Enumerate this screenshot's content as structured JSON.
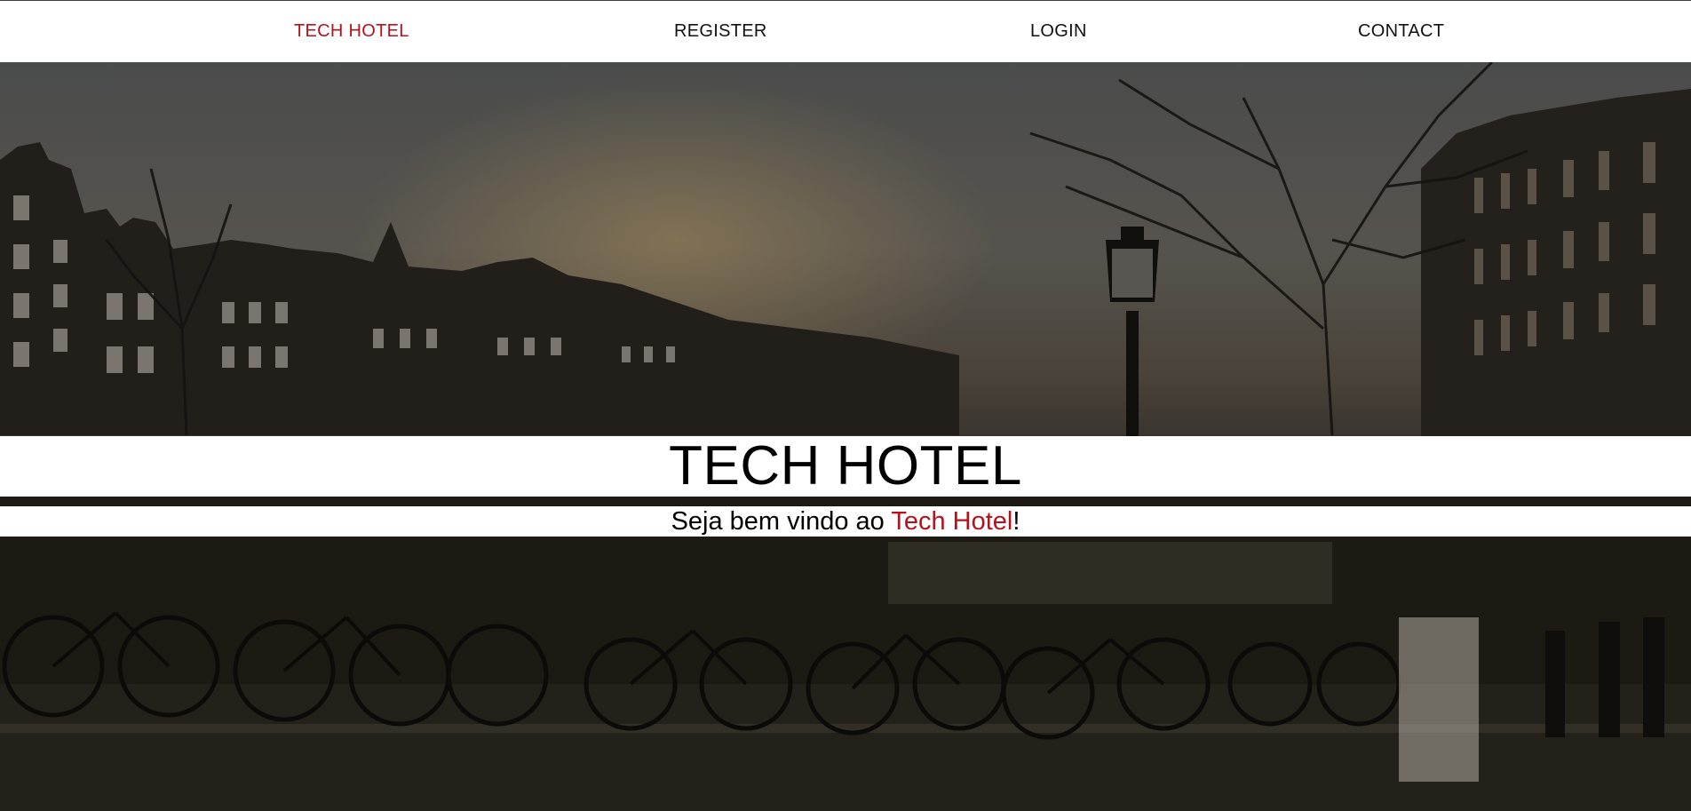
{
  "nav": {
    "brand": "TECH HOTEL",
    "items": [
      {
        "label": "REGISTER"
      },
      {
        "label": "LOGIN"
      },
      {
        "label": "CONTACT"
      }
    ]
  },
  "hero": {
    "title": "TECH HOTEL",
    "subtitle_prefix": "Seja bem vindo ao ",
    "subtitle_highlight": "Tech Hotel",
    "subtitle_suffix": "!",
    "background": "amsterdam-canal-bicycles-photo"
  },
  "colors": {
    "accent": "#b5121b",
    "text": "#000000",
    "band": "#ffffff"
  }
}
